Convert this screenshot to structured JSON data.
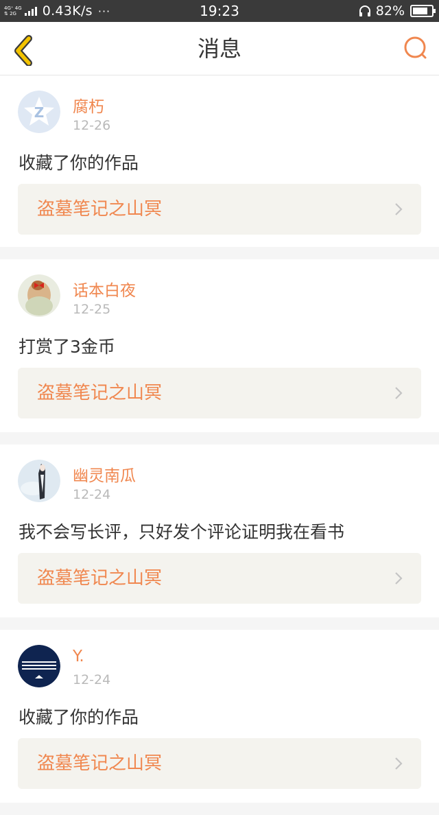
{
  "status_bar": {
    "net_top": "4G⁺ 4G",
    "net_bottom": "⇅ 2G",
    "speed": "0.43K/s",
    "dots": "···",
    "time": "19:23",
    "battery_pct": "82%",
    "battery_level": 0.82
  },
  "nav": {
    "title": "消息",
    "accent": "#f0874f",
    "back_color": "#f3c300"
  },
  "messages": [
    {
      "user": "腐朽",
      "date": "12-26",
      "text": "收藏了你的作品",
      "work": "盗墓笔记之山冥",
      "avatar": "qq-default-avatar"
    },
    {
      "user": "话本白夜",
      "date": "12-25",
      "text": "打赏了3金币",
      "work": "盗墓笔记之山冥",
      "avatar": "girl-photo-avatar"
    },
    {
      "user": "幽灵南瓜",
      "date": "12-24",
      "text": "我不会写长评，只好发个评论证明我在看书",
      "work": "盗墓笔记之山冥",
      "avatar": "anime-figure-avatar"
    },
    {
      "user": "Y.",
      "date": "12-24",
      "text": "收藏了你的作品",
      "work": "盗墓笔记之山冥",
      "avatar": "navy-logo-avatar"
    }
  ]
}
